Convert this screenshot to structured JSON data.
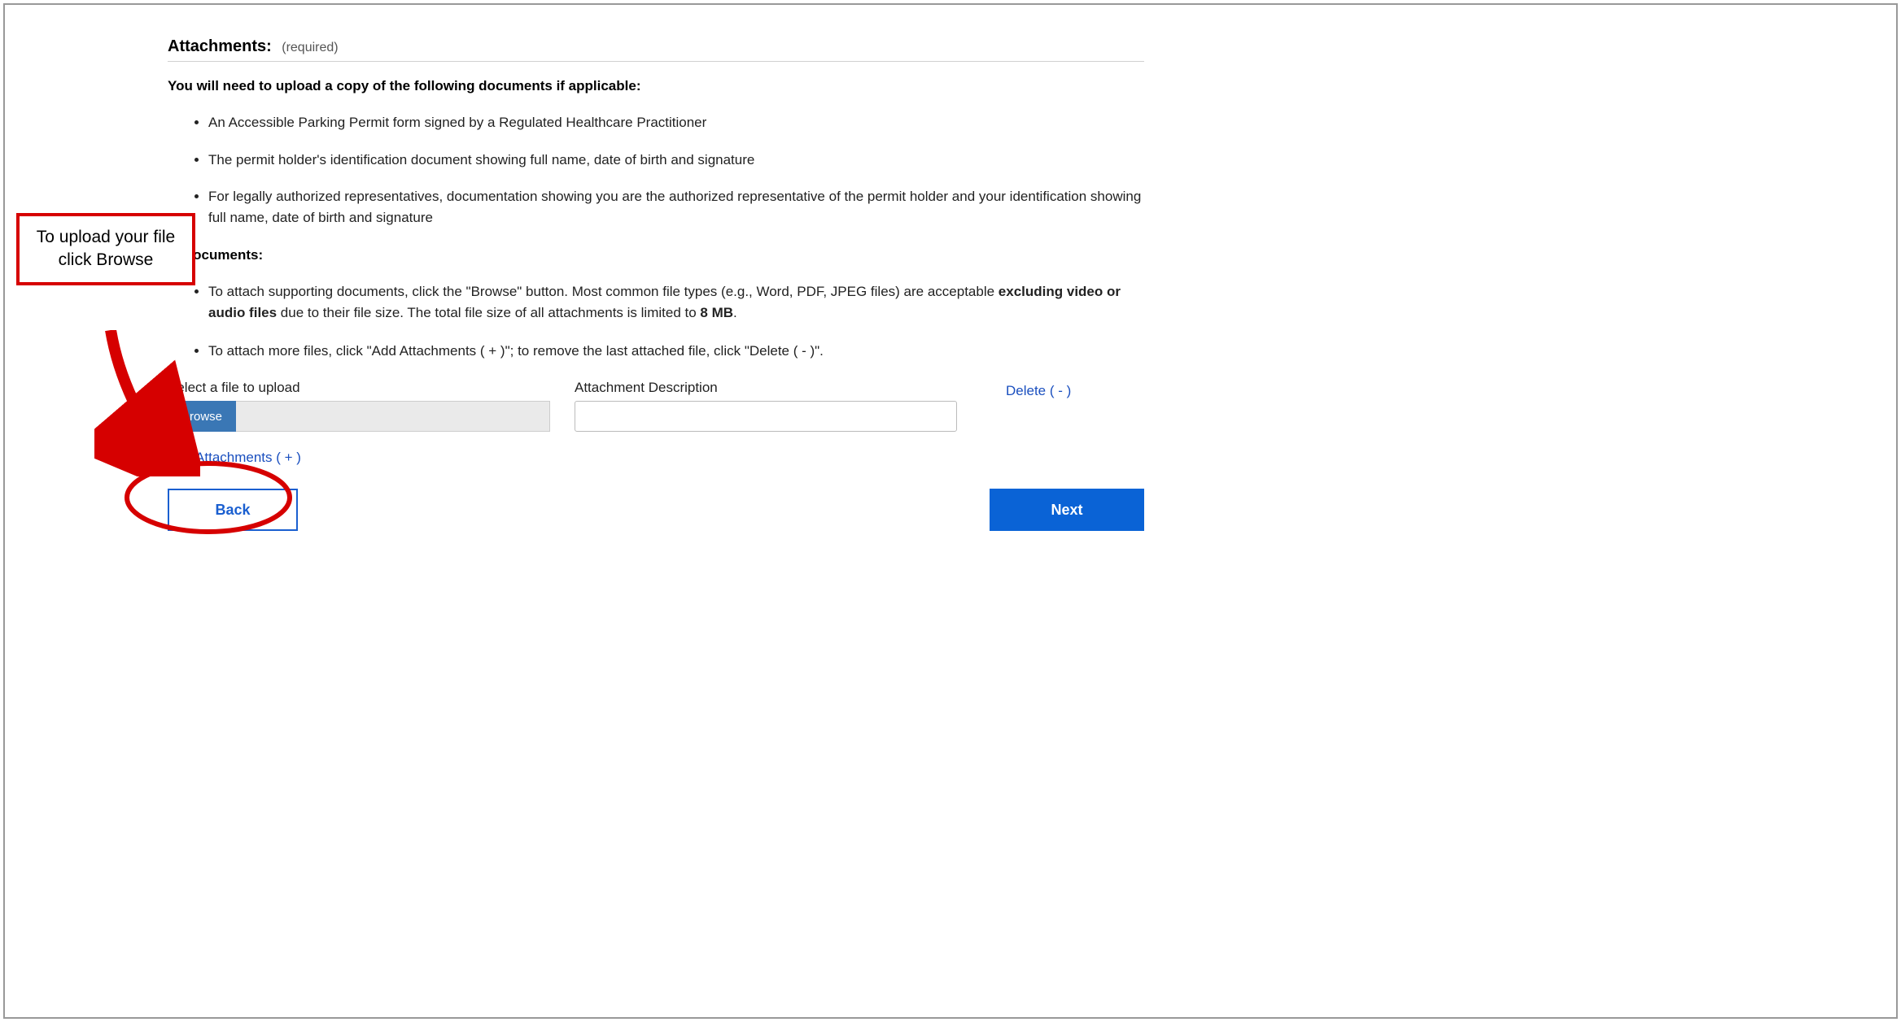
{
  "section": {
    "title": "Attachments:",
    "required": "(required)"
  },
  "instruction_lead": "You will need to upload a copy of the following documents if applicable:",
  "docs": [
    "An Accessible Parking Permit form signed by a Regulated Healthcare Practitioner",
    "The permit holder's identification document showing full name, date of birth and signature",
    "For legally authorized representatives, documentation showing you are the authorized representative of the permit holder and your identification showing full name, date of birth and signature"
  ],
  "attach_heading_suffix": "of documents:",
  "attach_items": {
    "a_pre": "To attach supporting documents, click the \"Browse\" button. Most common file types (e.g., Word, PDF, JPEG files) are acceptable ",
    "a_bold1": "excluding video or audio files",
    "a_mid": " due to their file size. The total file size of all attachments is limited to ",
    "a_bold2": "8 MB",
    "a_end": ".",
    "b": "To attach more files, click \"Add Attachments ( + )\"; to remove the last attached file, click \"Delete ( - )\"."
  },
  "upload": {
    "select_label": "Select a file to upload",
    "browse_label": "Browse",
    "desc_label": "Attachment Description",
    "delete_label": "Delete ( - )",
    "add_label": "Add Attachments ( + )"
  },
  "nav": {
    "back": "Back",
    "next": "Next"
  },
  "callout": "To upload your file click Browse"
}
